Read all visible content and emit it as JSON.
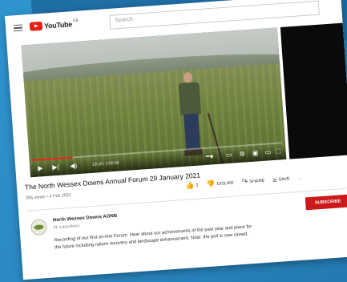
{
  "header": {
    "logo_text": "YouTube",
    "logo_sup": "GB",
    "search_placeholder": "Search"
  },
  "player": {
    "time": "19:29 / 2:00:58",
    "progress_fraction": 0.16
  },
  "video": {
    "title": "The North Wessex Downs Annual Forum 29 January 2021",
    "views": "265 views • 4 Feb 2021",
    "likes": "2",
    "dislike_label": "DISLIKE",
    "share_label": "SHARE",
    "save_label": "SAVE",
    "more": "..."
  },
  "channel": {
    "name": "North Wessex Downs AONB",
    "subscribers": "41 subscribers",
    "subscribe_label": "SUBSCRIBE"
  },
  "description": {
    "line1": "Recording of our first on-line Forum.  Hear about our achievements of the past year and plans for",
    "line2": "the future including nature recovery and landscape enhancement.  Note: the poll is now closed."
  },
  "colors": {
    "accent": "#e62117",
    "subscribe": "#cc1a1a",
    "background": "#2d8fc9"
  }
}
